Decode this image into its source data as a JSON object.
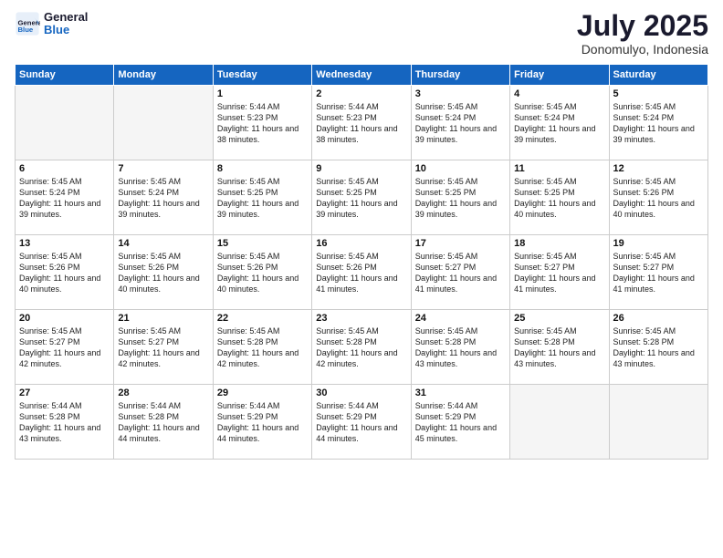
{
  "logo": {
    "line1": "General",
    "line2": "Blue"
  },
  "title": "July 2025",
  "location": "Donomulyo, Indonesia",
  "weekdays": [
    "Sunday",
    "Monday",
    "Tuesday",
    "Wednesday",
    "Thursday",
    "Friday",
    "Saturday"
  ],
  "weeks": [
    [
      {
        "day": "",
        "sunrise": "",
        "sunset": "",
        "daylight": "",
        "empty": true
      },
      {
        "day": "",
        "sunrise": "",
        "sunset": "",
        "daylight": "",
        "empty": true
      },
      {
        "day": "1",
        "sunrise": "Sunrise: 5:44 AM",
        "sunset": "Sunset: 5:23 PM",
        "daylight": "Daylight: 11 hours and 38 minutes.",
        "empty": false
      },
      {
        "day": "2",
        "sunrise": "Sunrise: 5:44 AM",
        "sunset": "Sunset: 5:23 PM",
        "daylight": "Daylight: 11 hours and 38 minutes.",
        "empty": false
      },
      {
        "day": "3",
        "sunrise": "Sunrise: 5:45 AM",
        "sunset": "Sunset: 5:24 PM",
        "daylight": "Daylight: 11 hours and 39 minutes.",
        "empty": false
      },
      {
        "day": "4",
        "sunrise": "Sunrise: 5:45 AM",
        "sunset": "Sunset: 5:24 PM",
        "daylight": "Daylight: 11 hours and 39 minutes.",
        "empty": false
      },
      {
        "day": "5",
        "sunrise": "Sunrise: 5:45 AM",
        "sunset": "Sunset: 5:24 PM",
        "daylight": "Daylight: 11 hours and 39 minutes.",
        "empty": false
      }
    ],
    [
      {
        "day": "6",
        "sunrise": "Sunrise: 5:45 AM",
        "sunset": "Sunset: 5:24 PM",
        "daylight": "Daylight: 11 hours and 39 minutes.",
        "empty": false
      },
      {
        "day": "7",
        "sunrise": "Sunrise: 5:45 AM",
        "sunset": "Sunset: 5:24 PM",
        "daylight": "Daylight: 11 hours and 39 minutes.",
        "empty": false
      },
      {
        "day": "8",
        "sunrise": "Sunrise: 5:45 AM",
        "sunset": "Sunset: 5:25 PM",
        "daylight": "Daylight: 11 hours and 39 minutes.",
        "empty": false
      },
      {
        "day": "9",
        "sunrise": "Sunrise: 5:45 AM",
        "sunset": "Sunset: 5:25 PM",
        "daylight": "Daylight: 11 hours and 39 minutes.",
        "empty": false
      },
      {
        "day": "10",
        "sunrise": "Sunrise: 5:45 AM",
        "sunset": "Sunset: 5:25 PM",
        "daylight": "Daylight: 11 hours and 39 minutes.",
        "empty": false
      },
      {
        "day": "11",
        "sunrise": "Sunrise: 5:45 AM",
        "sunset": "Sunset: 5:25 PM",
        "daylight": "Daylight: 11 hours and 40 minutes.",
        "empty": false
      },
      {
        "day": "12",
        "sunrise": "Sunrise: 5:45 AM",
        "sunset": "Sunset: 5:26 PM",
        "daylight": "Daylight: 11 hours and 40 minutes.",
        "empty": false
      }
    ],
    [
      {
        "day": "13",
        "sunrise": "Sunrise: 5:45 AM",
        "sunset": "Sunset: 5:26 PM",
        "daylight": "Daylight: 11 hours and 40 minutes.",
        "empty": false
      },
      {
        "day": "14",
        "sunrise": "Sunrise: 5:45 AM",
        "sunset": "Sunset: 5:26 PM",
        "daylight": "Daylight: 11 hours and 40 minutes.",
        "empty": false
      },
      {
        "day": "15",
        "sunrise": "Sunrise: 5:45 AM",
        "sunset": "Sunset: 5:26 PM",
        "daylight": "Daylight: 11 hours and 40 minutes.",
        "empty": false
      },
      {
        "day": "16",
        "sunrise": "Sunrise: 5:45 AM",
        "sunset": "Sunset: 5:26 PM",
        "daylight": "Daylight: 11 hours and 41 minutes.",
        "empty": false
      },
      {
        "day": "17",
        "sunrise": "Sunrise: 5:45 AM",
        "sunset": "Sunset: 5:27 PM",
        "daylight": "Daylight: 11 hours and 41 minutes.",
        "empty": false
      },
      {
        "day": "18",
        "sunrise": "Sunrise: 5:45 AM",
        "sunset": "Sunset: 5:27 PM",
        "daylight": "Daylight: 11 hours and 41 minutes.",
        "empty": false
      },
      {
        "day": "19",
        "sunrise": "Sunrise: 5:45 AM",
        "sunset": "Sunset: 5:27 PM",
        "daylight": "Daylight: 11 hours and 41 minutes.",
        "empty": false
      }
    ],
    [
      {
        "day": "20",
        "sunrise": "Sunrise: 5:45 AM",
        "sunset": "Sunset: 5:27 PM",
        "daylight": "Daylight: 11 hours and 42 minutes.",
        "empty": false
      },
      {
        "day": "21",
        "sunrise": "Sunrise: 5:45 AM",
        "sunset": "Sunset: 5:27 PM",
        "daylight": "Daylight: 11 hours and 42 minutes.",
        "empty": false
      },
      {
        "day": "22",
        "sunrise": "Sunrise: 5:45 AM",
        "sunset": "Sunset: 5:28 PM",
        "daylight": "Daylight: 11 hours and 42 minutes.",
        "empty": false
      },
      {
        "day": "23",
        "sunrise": "Sunrise: 5:45 AM",
        "sunset": "Sunset: 5:28 PM",
        "daylight": "Daylight: 11 hours and 42 minutes.",
        "empty": false
      },
      {
        "day": "24",
        "sunrise": "Sunrise: 5:45 AM",
        "sunset": "Sunset: 5:28 PM",
        "daylight": "Daylight: 11 hours and 43 minutes.",
        "empty": false
      },
      {
        "day": "25",
        "sunrise": "Sunrise: 5:45 AM",
        "sunset": "Sunset: 5:28 PM",
        "daylight": "Daylight: 11 hours and 43 minutes.",
        "empty": false
      },
      {
        "day": "26",
        "sunrise": "Sunrise: 5:45 AM",
        "sunset": "Sunset: 5:28 PM",
        "daylight": "Daylight: 11 hours and 43 minutes.",
        "empty": false
      }
    ],
    [
      {
        "day": "27",
        "sunrise": "Sunrise: 5:44 AM",
        "sunset": "Sunset: 5:28 PM",
        "daylight": "Daylight: 11 hours and 43 minutes.",
        "empty": false
      },
      {
        "day": "28",
        "sunrise": "Sunrise: 5:44 AM",
        "sunset": "Sunset: 5:28 PM",
        "daylight": "Daylight: 11 hours and 44 minutes.",
        "empty": false
      },
      {
        "day": "29",
        "sunrise": "Sunrise: 5:44 AM",
        "sunset": "Sunset: 5:29 PM",
        "daylight": "Daylight: 11 hours and 44 minutes.",
        "empty": false
      },
      {
        "day": "30",
        "sunrise": "Sunrise: 5:44 AM",
        "sunset": "Sunset: 5:29 PM",
        "daylight": "Daylight: 11 hours and 44 minutes.",
        "empty": false
      },
      {
        "day": "31",
        "sunrise": "Sunrise: 5:44 AM",
        "sunset": "Sunset: 5:29 PM",
        "daylight": "Daylight: 11 hours and 45 minutes.",
        "empty": false
      },
      {
        "day": "",
        "sunrise": "",
        "sunset": "",
        "daylight": "",
        "empty": true
      },
      {
        "day": "",
        "sunrise": "",
        "sunset": "",
        "daylight": "",
        "empty": true
      }
    ]
  ]
}
